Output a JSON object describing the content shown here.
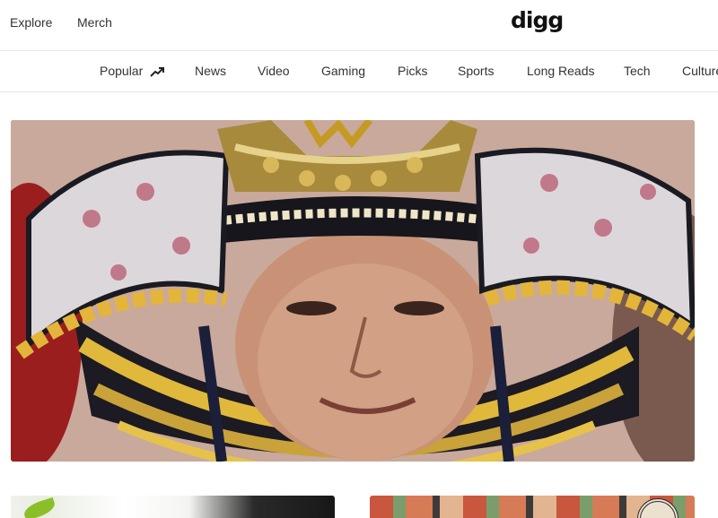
{
  "header": {
    "links": [
      {
        "label": "Explore"
      },
      {
        "label": "Merch"
      }
    ],
    "logo": "digg"
  },
  "nav": {
    "items": [
      {
        "label": "Popular",
        "icon": "trending-up-icon"
      },
      {
        "label": "News"
      },
      {
        "label": "Video"
      },
      {
        "label": "Gaming"
      },
      {
        "label": "Picks"
      },
      {
        "label": "Sports"
      },
      {
        "label": "Long Reads"
      },
      {
        "label": "Tech"
      },
      {
        "label": "Culture"
      }
    ]
  },
  "main": {
    "hero": {
      "image": "man-wearing-samurai-kabuto-helmet"
    },
    "cards": [
      {
        "image": "green-leaf-and-white-shirt"
      },
      {
        "image": "colorful-floral-tattoo-pattern"
      }
    ]
  },
  "colors": {
    "text": "#333333",
    "divider": "#e6e6e6",
    "logo": "#111111"
  }
}
